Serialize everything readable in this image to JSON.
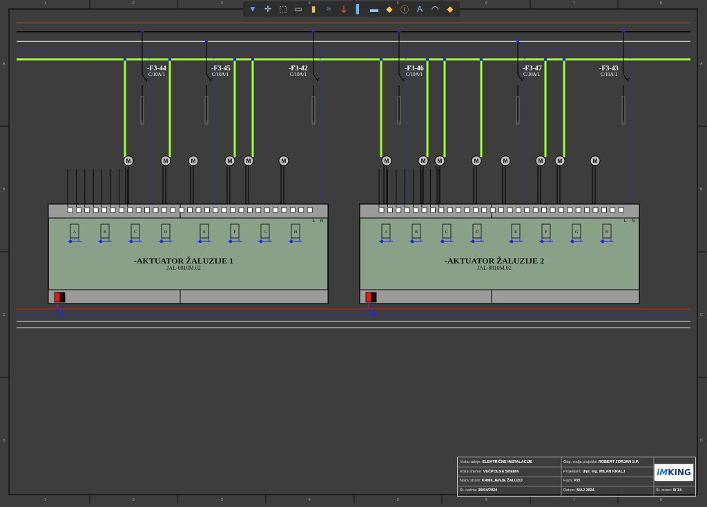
{
  "toolbar": {
    "tools": [
      "filter-icon",
      "crosshair-icon",
      "select-rect-icon",
      "save-icon",
      "document-icon",
      "wire-icon",
      "ground-icon",
      "bus-icon",
      "component-icon",
      "tag-icon",
      "info-icon",
      "text-icon",
      "arc-icon",
      "marker-icon"
    ],
    "tool_glyphs": [
      "▼",
      "✛",
      "⬚",
      "▭",
      "▮",
      "≈",
      "⏚",
      "▌",
      "▬",
      "◆",
      "ⓘ",
      "A",
      "◠",
      "◆"
    ],
    "colors": [
      "#4fa3ff",
      "#9fd0ff",
      "#cfd6e0",
      "#b8c4cf",
      "#e0c060",
      "#7fb0e0",
      "#ff6a3d",
      "#6fb3ff",
      "#9ad0ff",
      "#ffd24d",
      "#ff8a5c",
      "#7fb6ff",
      "#c8d8ff",
      "#ffc34d"
    ]
  },
  "grid": {
    "columns": [
      "1",
      "2",
      "3",
      "4",
      "5",
      "6",
      "7",
      "8"
    ],
    "rows": [
      "A",
      "B",
      "C",
      "D"
    ]
  },
  "breakers_left": [
    {
      "id": "-F3-44",
      "rating": "C/10A/1"
    },
    {
      "id": "-F3-45",
      "rating": "C/10A/1"
    },
    {
      "id": "-F3-42",
      "rating": "C/10A/1"
    }
  ],
  "breakers_right": [
    {
      "id": "-F3-46",
      "rating": "C/10A/1"
    },
    {
      "id": "-F3-47",
      "rating": "C/10A/1"
    },
    {
      "id": "-F3-43",
      "rating": "C/10A/1"
    }
  ],
  "actuators": [
    {
      "title": "-AKTUATOR ŽALUZIJE 1",
      "model": "JAL-0810M.02",
      "channels": [
        "A",
        "B",
        "C",
        "D",
        "E",
        "F",
        "G",
        "H"
      ],
      "ln": [
        "L",
        "N"
      ]
    },
    {
      "title": "-AKTUATOR ŽALUZIJE 2",
      "model": "JAL-0810M.02",
      "channels": [
        "A",
        "B",
        "C",
        "D",
        "E",
        "F",
        "G",
        "H"
      ],
      "ln": [
        "L",
        "N"
      ]
    }
  ],
  "motor_label": "M",
  "title_block": {
    "vrsta_radnje_label": "Vrsta radnje:",
    "vrsta_radnje": "ELEKTRIČNE INSTALACIJE",
    "vrsta_sheme_label": "Vrsta sheme:",
    "vrsta_sheme": "VEĆPOLNA SHEMA",
    "naziv_strani_label": "Naziv strani:",
    "naziv_strani": "KRMILJENJE ŽALUZIJ",
    "st_nacrta_label": "Št. načrta:",
    "st_nacrta": "29/04/2024",
    "odg_label": "Odg. vodja projekta:",
    "odg": "ROBERT ZORJAN S.P.",
    "projektant_label": "Projektant:",
    "projektant": "dipl. ing. MILAN KRALJ",
    "faza_label": "Faza:",
    "faza": "PZI",
    "datum_label": "Datum:",
    "datum": "MAJ 2024",
    "st_strani_label": "Št. strani:",
    "st_strani": "9/ 14",
    "logo_im": "iM",
    "logo_king": "KING"
  },
  "colors": {
    "background": "#3d3d3d",
    "bus_green": "#9bff3a",
    "actuator_fill": "#8aa088",
    "actuator_border": "#000000",
    "wire_blue": "#1d2bd6",
    "wire_brown": "#8a4b1f",
    "wire_white": "#e6e6e6",
    "label_red": "#d61a1a"
  }
}
